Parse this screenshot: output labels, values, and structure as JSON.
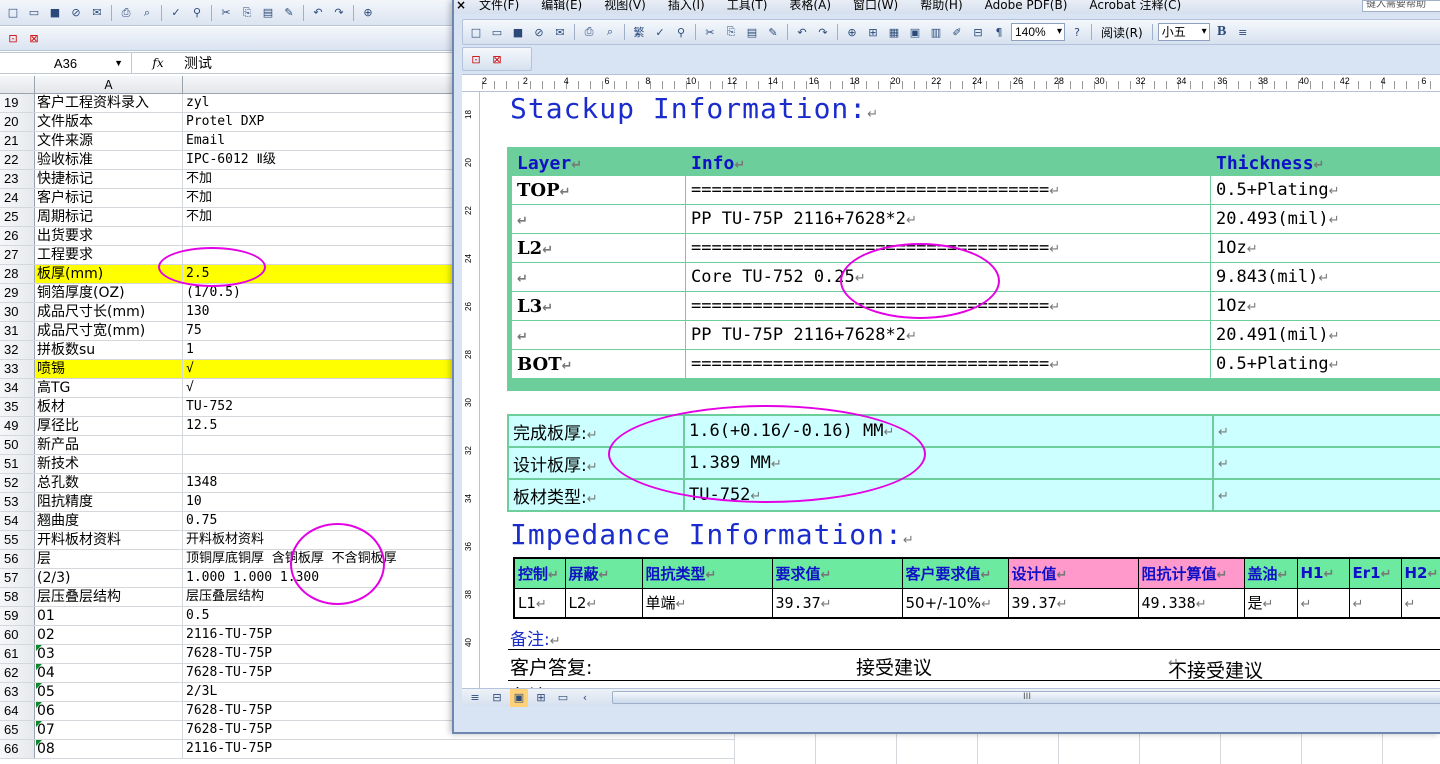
{
  "excel": {
    "name_box": "A36",
    "fx_label": "fx",
    "formula_value": "测试",
    "column_header": "A",
    "rows": [
      {
        "n": "19",
        "a": "客户工程资料录入",
        "b": "zyl"
      },
      {
        "n": "20",
        "a": "文件版本",
        "b": "Protel DXP"
      },
      {
        "n": "21",
        "a": "文件来源",
        "b": "Email"
      },
      {
        "n": "22",
        "a": "验收标准",
        "b": "IPC-6012 Ⅱ级"
      },
      {
        "n": "23",
        "a": "快捷标记",
        "b": "不加"
      },
      {
        "n": "24",
        "a": "客户标记",
        "b": "不加"
      },
      {
        "n": "25",
        "a": "周期标记",
        "b": "不加"
      },
      {
        "n": "26",
        "a": "出货要求",
        "b": ""
      },
      {
        "n": "27",
        "a": "工程要求",
        "b": ""
      },
      {
        "n": "28",
        "a": "板厚(mm)",
        "b": "2.5",
        "highlight": true
      },
      {
        "n": "29",
        "a": "铜箔厚度(OZ)",
        "b": "(1/0.5)"
      },
      {
        "n": "30",
        "a": "成品尺寸长(mm)",
        "b": "130"
      },
      {
        "n": "31",
        "a": "成品尺寸宽(mm)",
        "b": "75"
      },
      {
        "n": "32",
        "a": "拼板数su",
        "b": "1"
      },
      {
        "n": "33",
        "a": "喷锡",
        "b": "√",
        "highlight": true
      },
      {
        "n": "34",
        "a": "高TG",
        "b": "√"
      },
      {
        "n": "35",
        "a": "板材",
        "b": "TU-752"
      },
      {
        "n": "49",
        "a": "厚径比",
        "b": "12.5"
      },
      {
        "n": "50",
        "a": "新产品",
        "b": ""
      },
      {
        "n": "51",
        "a": "新技术",
        "b": ""
      },
      {
        "n": "52",
        "a": "总孔数",
        "b": "1348"
      },
      {
        "n": "53",
        "a": "阻抗精度",
        "b": "10"
      },
      {
        "n": "54",
        "a": "翘曲度",
        "b": "0.75"
      },
      {
        "n": "55",
        "a": "开料板材资料",
        "b": "开料板材资料"
      },
      {
        "n": "56",
        "a": "层",
        "b": "顶铜厚底铜厚 含铜板厚 不含铜板厚"
      },
      {
        "n": "57",
        "a": "(2/3)",
        "b": "1.000  1.000   1.300"
      },
      {
        "n": "58",
        "a": "层压叠层结构",
        "b": "层压叠层结构"
      },
      {
        "n": "59",
        "a": "01",
        "b": "0.5"
      },
      {
        "n": "60",
        "a": "02",
        "b": "2116-TU-75P"
      },
      {
        "n": "61",
        "a": "03",
        "b": "7628-TU-75P"
      },
      {
        "n": "62",
        "a": "04",
        "b": "7628-TU-75P"
      },
      {
        "n": "63",
        "a": "05",
        "b": "2/3L"
      },
      {
        "n": "64",
        "a": "06",
        "b": "7628-TU-75P"
      },
      {
        "n": "65",
        "a": "07",
        "b": "7628-TU-75P"
      },
      {
        "n": "66",
        "a": "08",
        "b": "2116-TU-75P"
      }
    ]
  },
  "word": {
    "menu": [
      "文件(F)",
      "编辑(E)",
      "视图(V)",
      "插入(I)",
      "工具(T)",
      "表格(A)",
      "窗口(W)",
      "帮助(H)",
      "Adobe PDF(B)",
      "Acrobat 注释(C)"
    ],
    "help_placeholder": "键入需要帮助",
    "toolbar": {
      "trad_label": "繁",
      "zoom": "140%",
      "read_label": "阅读(R)",
      "font_size": "小五",
      "bold_label": "B"
    },
    "ruler_numbers": [
      "2",
      "",
      "2",
      "",
      "4",
      "",
      "6",
      "",
      "8",
      "",
      "10",
      "",
      "12",
      "",
      "14",
      "",
      "16",
      "",
      "18",
      "",
      "20",
      "",
      "22",
      "",
      "24",
      "",
      "26",
      "",
      "28",
      "",
      "30",
      "",
      "32",
      "",
      "34",
      "",
      "36",
      "",
      "38",
      "",
      "40",
      "",
      "42",
      "",
      "4",
      "",
      "6"
    ],
    "vruler_numbers": [
      "18",
      "20",
      "22",
      "24",
      "26",
      "28",
      "30",
      "32",
      "34",
      "36",
      "38",
      "40"
    ],
    "para_mark": "↵",
    "stackup_title": "Stackup Information:",
    "stackup_headers": [
      "Layer",
      "Info",
      "Thickness"
    ],
    "stackup_rows": [
      {
        "layer": "TOP",
        "info": "===================================",
        "thick": "0.5+Plating"
      },
      {
        "layer": "",
        "info": "PP     TU-75P    2116+7628*2",
        "thick": "20.493(mil)"
      },
      {
        "layer": "L2",
        "info": "===================================",
        "thick": "1Oz"
      },
      {
        "layer": "",
        "info": "Core     TU-752    0.25",
        "thick": "9.843(mil)"
      },
      {
        "layer": "L3",
        "info": "===================================",
        "thick": "1Oz"
      },
      {
        "layer": "",
        "info": "PP     TU-75P    2116+7628*2",
        "thick": "20.491(mil)"
      },
      {
        "layer": "BOT",
        "info": "===================================",
        "thick": "0.5+Plating"
      }
    ],
    "finish_rows": [
      {
        "label": "完成板厚:",
        "value": "1.6(+0.16/-0.16) MM"
      },
      {
        "label": "设计板厚:",
        "value": "1.389 MM"
      },
      {
        "label": "板材类型:",
        "value": "TU-752"
      }
    ],
    "impedance_title": "Impedance Information:",
    "impedance_headers": [
      "控制",
      "屏蔽",
      "阻抗类型",
      "要求值",
      "客户要求值",
      "设计值",
      "阻抗计算值",
      "盖油",
      "H1",
      "Er1",
      "H2"
    ],
    "impedance_rows": [
      [
        "L1",
        "L2",
        "单端",
        "39.37",
        "50+/-10%",
        "39.37",
        "49.338",
        "是",
        "",
        "",
        ""
      ]
    ],
    "note_label": "备注:",
    "reply_label": "客户答复:",
    "accept_label": "接受建议",
    "reject_label": "不接受建议",
    "note_label_cut": "备注",
    "scroll_mark": "III"
  },
  "colors": {
    "accent_green": "#6ccf9b",
    "cyan_fill": "#ccffff",
    "pink_header": "#ff99cc",
    "highlight_yellow": "#ffff00",
    "title_blue": "#1a2dcc",
    "annotation_magenta": "#e400e4"
  }
}
